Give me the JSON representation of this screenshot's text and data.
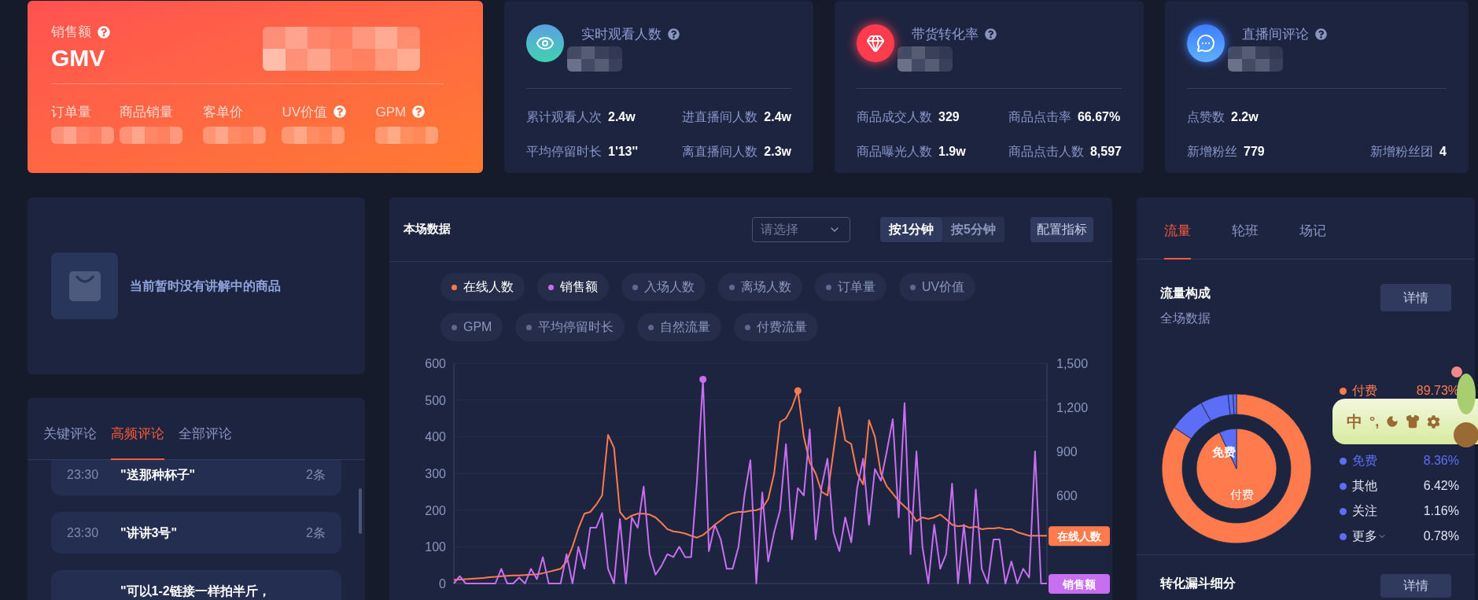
{
  "summary_cards": [
    {
      "kind": "gmv",
      "label": "销售额",
      "help": true,
      "title": "GMV",
      "redacted": true,
      "rows": [
        [
          {
            "label": "订单量",
            "help": false,
            "redacted": true
          },
          {
            "label": "商品销量",
            "help": false,
            "redacted": true
          },
          {
            "label": "客单价",
            "help": false,
            "redacted": true
          },
          {
            "label": "UV价值",
            "help": true,
            "redacted": true
          },
          {
            "label": "GPM",
            "help": true,
            "redacted": true
          }
        ]
      ]
    },
    {
      "kind": "metric",
      "title": "实时观看人数",
      "help": true,
      "redacted": true,
      "rows": [
        [
          {
            "label": "累计观看人次",
            "value": "2.4w"
          },
          {
            "label": "进直播间人数",
            "value": "2.4w"
          }
        ],
        [
          {
            "label": "平均停留时长",
            "value": "1'13''"
          },
          {
            "label": "离直播间人数",
            "value": "2.3w"
          }
        ]
      ]
    },
    {
      "kind": "metric",
      "title": "带货转化率",
      "help": true,
      "redacted": true,
      "rows": [
        [
          {
            "label": "商品成交人数",
            "value": "329"
          },
          {
            "label": "商品点击率",
            "value": "66.67%"
          }
        ],
        [
          {
            "label": "商品曝光人数",
            "value": "1.9w"
          },
          {
            "label": "商品点击人数",
            "value": "8,597"
          }
        ]
      ]
    },
    {
      "kind": "metric",
      "title": "直播间评论",
      "help": true,
      "redacted": true,
      "rows": [
        [
          {
            "label": "点赞数",
            "value": "2.2w"
          }
        ],
        [
          {
            "label": "新增粉丝",
            "value": "779"
          },
          {
            "label": "新增粉丝团",
            "value": "4"
          }
        ]
      ]
    }
  ],
  "product_card": {
    "message": "当前暂时没有讲解中的商品"
  },
  "comments": {
    "tabs": [
      {
        "label": "关键评论",
        "selected": false
      },
      {
        "label": "高频评论",
        "selected": true
      },
      {
        "label": "全部评论",
        "selected": false
      }
    ],
    "items": [
      {
        "time": "23:30",
        "text": "\"送那种杯子\"",
        "count": "2条"
      },
      {
        "time": "23:30",
        "text": "\"讲讲3号\"",
        "count": "2条"
      },
      {
        "text": "\"可以1-2链接一样拍半斤，"
      }
    ]
  },
  "live_data": {
    "title": "本场数据",
    "select": {
      "placeholder": "请选择"
    },
    "granularity": [
      {
        "label": "按1分钟",
        "selected": true
      },
      {
        "label": "按5分钟",
        "selected": false
      }
    ],
    "config_button": "配置指标",
    "metrics": [
      {
        "label": "在线人数",
        "selected": true,
        "color": "#ff7a4d"
      },
      {
        "label": "销售额",
        "selected": true,
        "color": "#c86ef0"
      },
      {
        "label": "入场人数",
        "selected": false,
        "color": "#5d6a8f"
      },
      {
        "label": "离场人数",
        "selected": false,
        "color": "#5d6a8f"
      },
      {
        "label": "订单量",
        "selected": false,
        "color": "#5d6a8f"
      },
      {
        "label": "UV价值",
        "selected": false,
        "color": "#5d6a8f"
      },
      {
        "label": "GPM",
        "selected": false,
        "color": "#5d6a8f"
      },
      {
        "label": "平均停留时长",
        "selected": false,
        "color": "#5d6a8f"
      },
      {
        "label": "自然流量",
        "selected": false,
        "color": "#5d6a8f"
      },
      {
        "label": "付费流量",
        "selected": false,
        "color": "#5d6a8f"
      }
    ],
    "chart_data": {
      "type": "line",
      "grid": true,
      "ylim": [
        0,
        600
      ],
      "yticks": [
        0,
        100,
        200,
        300,
        400,
        500,
        600
      ],
      "y2lim": [
        0,
        1500
      ],
      "y2ticks": [
        {
          "value": 600,
          "label": "600"
        },
        {
          "value": 900,
          "label": "900"
        },
        {
          "value": 1200,
          "label": "1,200"
        },
        {
          "value": 1500,
          "label": "1,500"
        }
      ],
      "series": [
        {
          "name": "在线人数",
          "color": "#ff7a4d",
          "values": [
            10,
            11,
            12,
            13,
            14,
            15,
            17,
            18,
            20,
            21,
            22,
            22,
            23,
            24,
            25,
            28,
            32,
            36,
            40,
            60,
            100,
            150,
            190,
            195,
            215,
            240,
            405,
            370,
            195,
            175,
            185,
            190,
            190,
            188,
            180,
            165,
            148,
            142,
            140,
            136,
            130,
            125,
            132,
            145,
            160,
            172,
            185,
            192,
            195,
            195,
            198,
            200,
            205,
            230,
            300,
            440,
            450,
            480,
            525,
            400,
            330,
            300,
            250,
            240,
            360,
            480,
            390,
            380,
            300,
            270,
            445,
            400,
            300,
            265,
            245,
            225,
            210,
            195,
            170,
            180,
            176,
            180,
            188,
            175,
            160,
            156,
            158,
            152,
            155,
            148,
            150,
            150,
            152,
            148,
            148,
            140,
            135,
            130,
            130,
            130,
            130
          ]
        },
        {
          "name": "销售额",
          "color": "#c86ef0",
          "axis": "y2",
          "values": [
            0,
            50,
            0,
            0,
            0,
            0,
            0,
            0,
            100,
            0,
            0,
            40,
            0,
            100,
            30,
            180,
            0,
            0,
            0,
            200,
            0,
            250,
            100,
            380,
            380,
            480,
            100,
            0,
            440,
            0,
            450,
            380,
            660,
            200,
            60,
            120,
            200,
            180,
            250,
            180,
            180,
            700,
            1390,
            220,
            400,
            300,
            100,
            100,
            250,
            600,
            840,
            0,
            620,
            150,
            350,
            500,
            950,
            300,
            650,
            600,
            1050,
            300,
            660,
            850,
            350,
            220,
            450,
            280,
            650,
            850,
            400,
            780,
            700,
            900,
            1120,
            450,
            1230,
            200,
            900,
            250,
            0,
            400,
            100,
            200,
            680,
            0,
            400,
            0,
            640,
            100,
            0,
            300,
            300,
            0,
            150,
            0,
            100,
            40,
            900,
            0,
            0
          ]
        }
      ]
    }
  },
  "traffic": {
    "tabs": [
      {
        "label": "流量",
        "selected": true
      },
      {
        "label": "轮班",
        "selected": false
      },
      {
        "label": "场记",
        "selected": false
      }
    ],
    "title": "流量构成",
    "subtitle": "全场数据",
    "detail_button": "详情",
    "chart_data": {
      "type": "donut",
      "categories": [
        "付费",
        "免费",
        "其他",
        "关注",
        "更多"
      ],
      "colors": [
        "#ff7a4d",
        "#5b6ef5",
        "#5b6ef5",
        "#5b6ef5",
        "#5b6ef5"
      ],
      "series": [
        {
          "values": [
            84.3,
            7.85,
            6.03,
            1.09,
            0.73
          ]
        },
        {
          "values": [
            93,
            7,
            null,
            null,
            null
          ]
        }
      ]
    },
    "inner_labels": [
      "免费",
      "付费"
    ],
    "legend": [
      {
        "percent": "89.73%",
        "highlighted": true
      },
      {
        "percent": "8.36%",
        "highlighted": true
      },
      {
        "percent": "6.42%",
        "highlighted": false
      },
      {
        "percent": "1.16%",
        "highlighted": false
      },
      {
        "percent": "0.78%",
        "highlighted": false,
        "expandable": true
      }
    ],
    "funnel": {
      "title": "转化漏斗细分",
      "detail_button": "详情"
    }
  },
  "ime": {
    "mode": "中",
    "punct": "°,"
  }
}
